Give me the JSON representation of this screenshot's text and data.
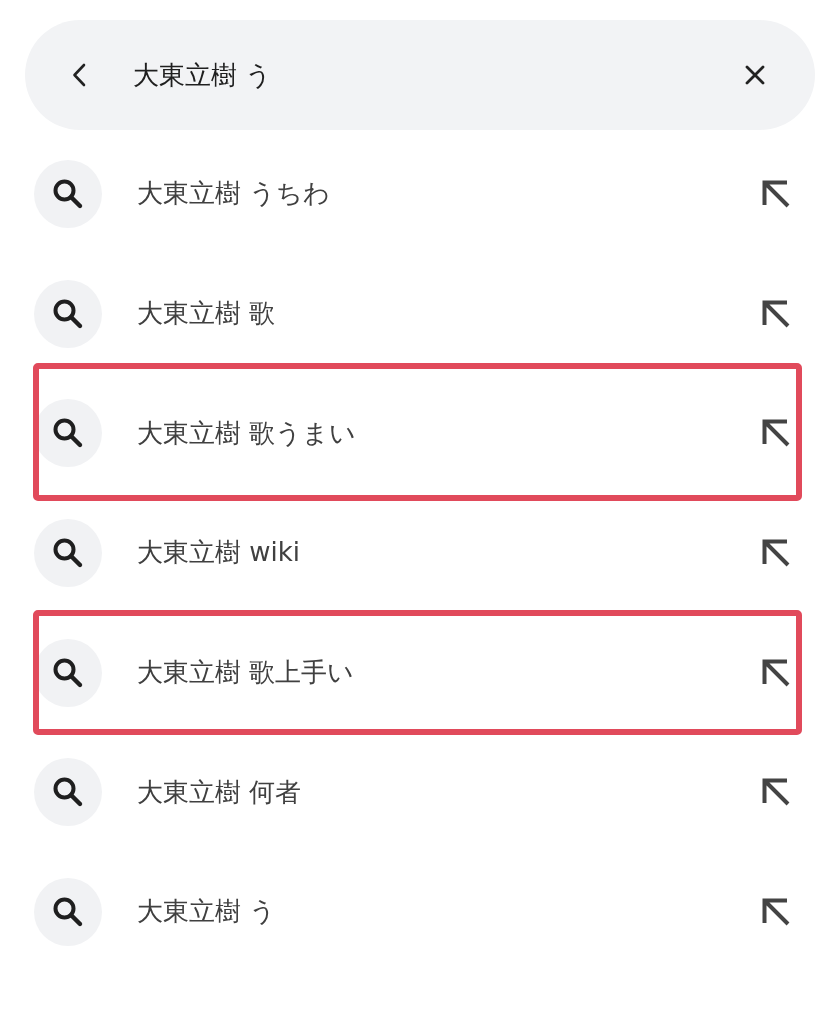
{
  "search": {
    "value": "大東立樹 う"
  },
  "suggestions": [
    {
      "text": "大東立樹 うちわ",
      "highlighted": false
    },
    {
      "text": "大東立樹 歌",
      "highlighted": false
    },
    {
      "text": "大東立樹 歌うまい",
      "highlighted": true
    },
    {
      "text": "大東立樹 wiki",
      "highlighted": false
    },
    {
      "text": "大東立樹 歌上手い",
      "highlighted": true
    },
    {
      "text": "大東立樹 何者",
      "highlighted": false
    },
    {
      "text": "大東立樹 う",
      "highlighted": false
    }
  ]
}
